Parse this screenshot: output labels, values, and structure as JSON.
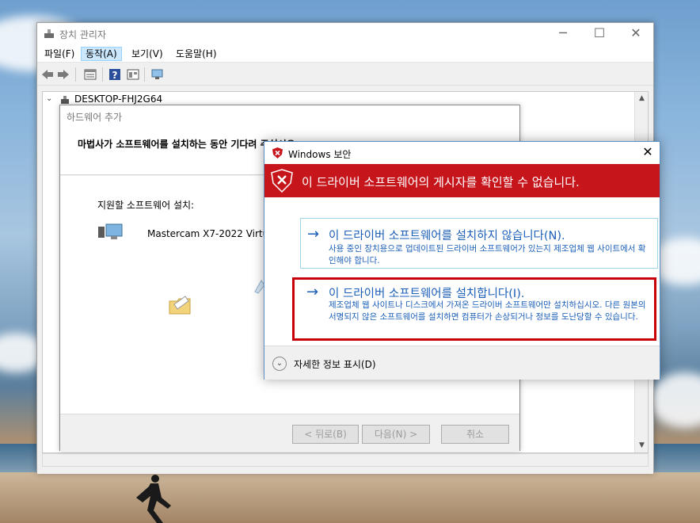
{
  "device_manager": {
    "title": "장치 관리자",
    "menu": [
      "파일(F)",
      "동작(A)",
      "보기(V)",
      "도움말(H)"
    ],
    "active_menu_index": 1,
    "tree_root": "DESKTOP-FHJ2G64"
  },
  "wizard": {
    "title": "하드웨어 추가",
    "heading": "마법사가 소프트웨어를 설치하는 동안 기다려 주십시오.",
    "subheading": "지원할 소프트웨어 설치:",
    "device_name": "Mastercam X7-2022 Virtual",
    "buttons": {
      "back": "< 뒤로(B)",
      "next": "다음(N) >",
      "cancel": "취소"
    }
  },
  "security_dialog": {
    "title": "Windows 보안",
    "banner": "이 드라이버 소프트웨어의 게시자를 확인할 수 없습니다.",
    "option_dont_install": {
      "arrow": "→",
      "title": "이 드라이버 소프트웨어를 설치하지 않습니다(N).",
      "description": "사용 중인 장치용으로 업데이트된 드라이버 소프트웨어가 있는지 제조업체 웹 사이트에서 확인해야 합니다."
    },
    "option_install": {
      "arrow": "→",
      "title": "이 드라이버 소프트웨어를 설치합니다(I).",
      "description": "제조업체 웹 사이트나 디스크에서 가져온 드라이버 소프트웨어만 설치하십시오. 다른 원본의 서명되지 않은 소프트웨어를 설치하면 컴퓨터가 손상되거나 정보를 도난당할 수 있습니다."
    },
    "details": "자세한 정보 표시(D)"
  },
  "icons": {
    "minimize": "─",
    "maximize": "☐",
    "close": "✕",
    "chevron_down": "⌄"
  },
  "colors": {
    "banner_red": "#c6161c",
    "link_blue": "#1b5fb8",
    "highlight_border": "#c8000a"
  }
}
